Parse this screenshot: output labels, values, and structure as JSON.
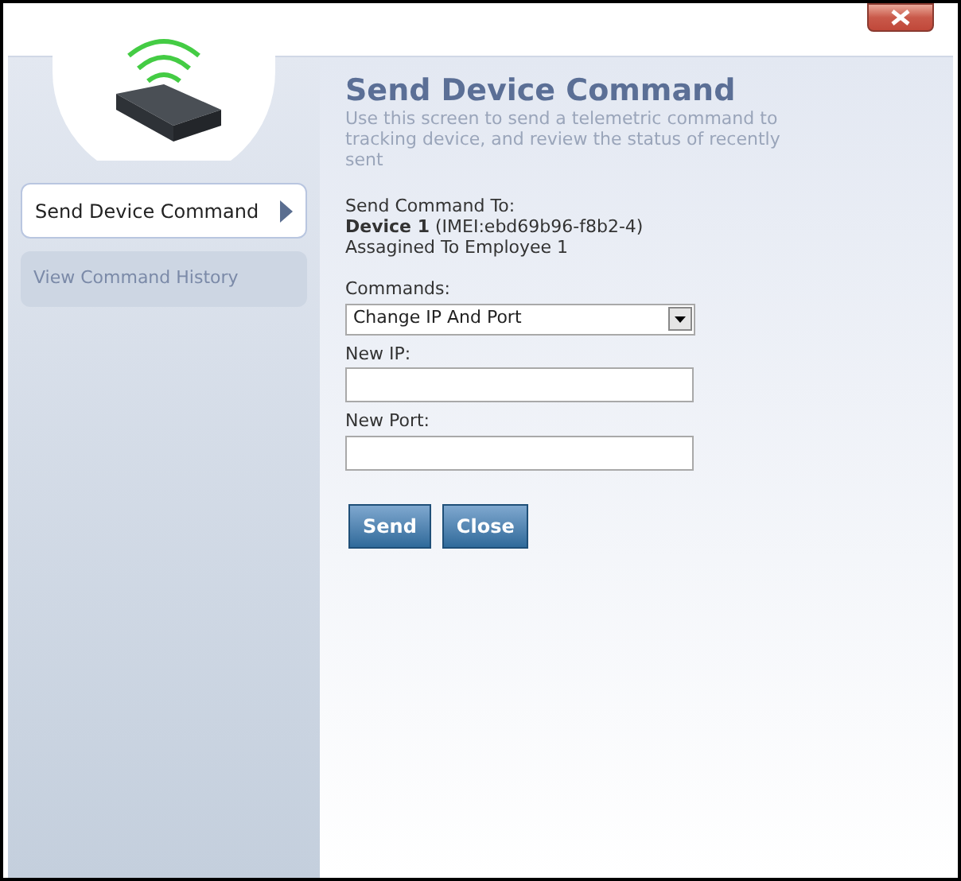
{
  "sidebar": {
    "items": [
      {
        "label": "Send Device Command",
        "selected": true
      },
      {
        "label": "View Command History",
        "selected": false
      }
    ]
  },
  "header": {
    "title": "Send Device Command",
    "description": "Use this screen to send a telemetric command to tracking device, and review the status of recently sent"
  },
  "target": {
    "label": "Send Command To:",
    "device": "**Device 1** (IMEI:ebd69b96-f8b2-4)",
    "assigned": "Assagined To Employee 1"
  },
  "form": {
    "commands": {
      "label": "Commands:",
      "value": "Change IP And Port"
    },
    "fields": [
      {
        "label": "New IP:"
      },
      {
        "label": "New Port:"
      }
    ]
  },
  "buttons": [
    "Send",
    "Close"
  ]
}
